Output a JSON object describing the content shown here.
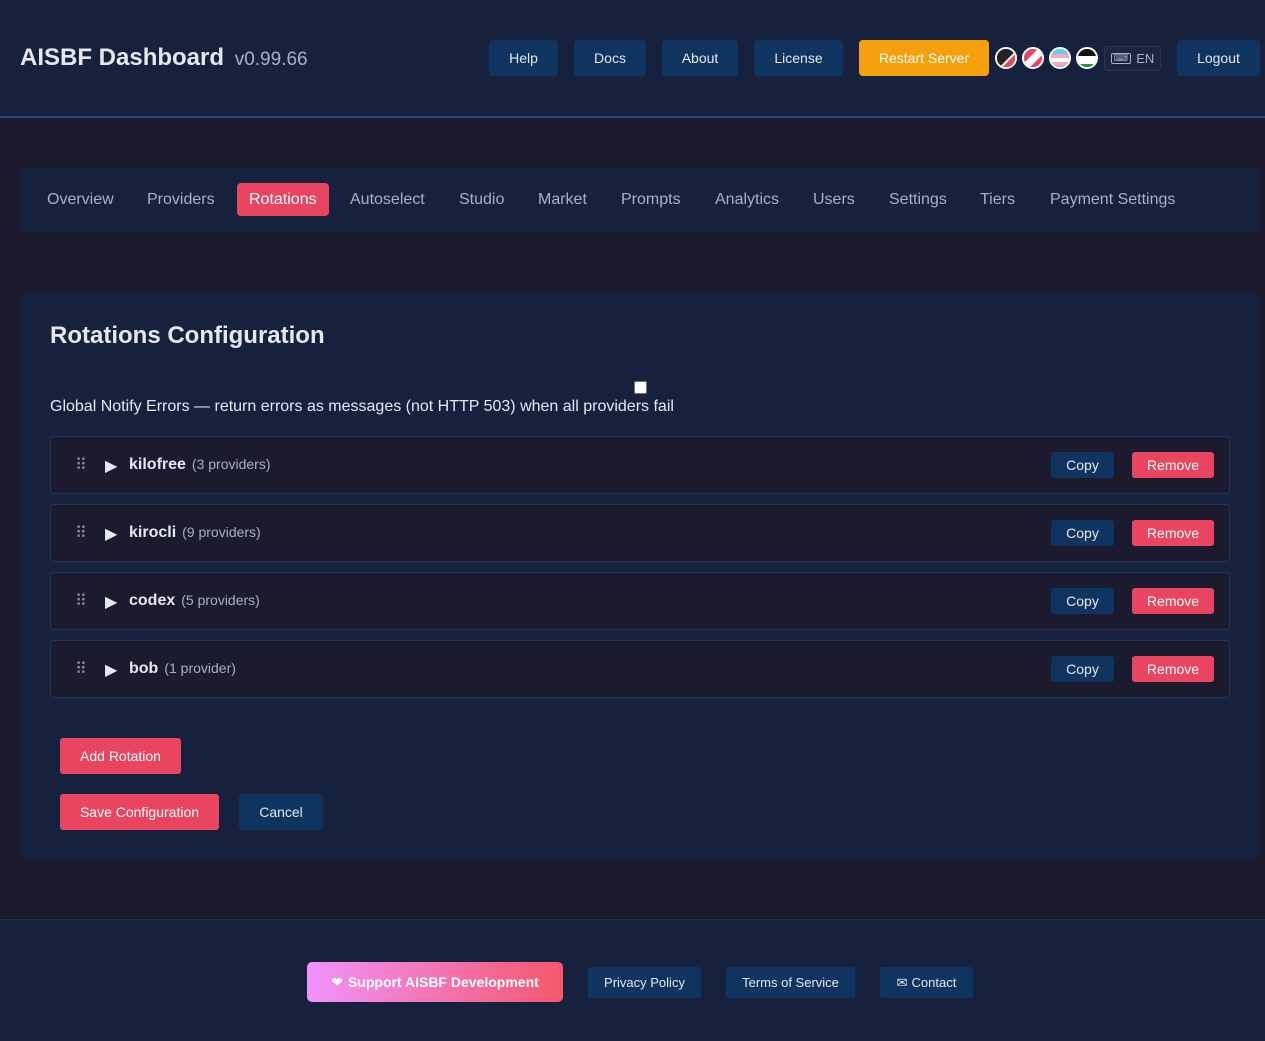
{
  "header": {
    "title": "AISBF Dashboard",
    "version": "v0.99.66",
    "buttons": {
      "help": "Help",
      "docs": "Docs",
      "about": "About",
      "license": "License",
      "restart": "Restart Server",
      "logout": "Logout"
    },
    "language": "EN"
  },
  "tabs": [
    "Overview",
    "Providers",
    "Rotations",
    "Autoselect",
    "Studio",
    "Market",
    "Prompts",
    "Analytics",
    "Users",
    "Settings",
    "Tiers",
    "Payment Settings"
  ],
  "active_tab": "Rotations",
  "main": {
    "title": "Rotations Configuration",
    "notify_label": "Global Notify Errors — return errors as messages (not HTTP 503) when all providers fail",
    "notify_checked": false,
    "rotations": [
      {
        "name": "kilofree",
        "count": "(3 providers)"
      },
      {
        "name": "kirocli",
        "count": "(9 providers)"
      },
      {
        "name": "codex",
        "count": "(5 providers)"
      },
      {
        "name": "bob",
        "count": "(1 provider)"
      }
    ],
    "copy_label": "Copy",
    "remove_label": "Remove",
    "add_rotation": "Add Rotation",
    "save": "Save Configuration",
    "cancel": "Cancel"
  },
  "footer": {
    "support": "Support AISBF Development",
    "privacy": "Privacy Policy",
    "terms": "Terms of Service",
    "contact": "Contact"
  },
  "colors": {
    "accent": "#e94560",
    "button": "#0f3460",
    "restart": "#f5a00f",
    "background": "#1b1a2e",
    "panel": "#16213e"
  }
}
